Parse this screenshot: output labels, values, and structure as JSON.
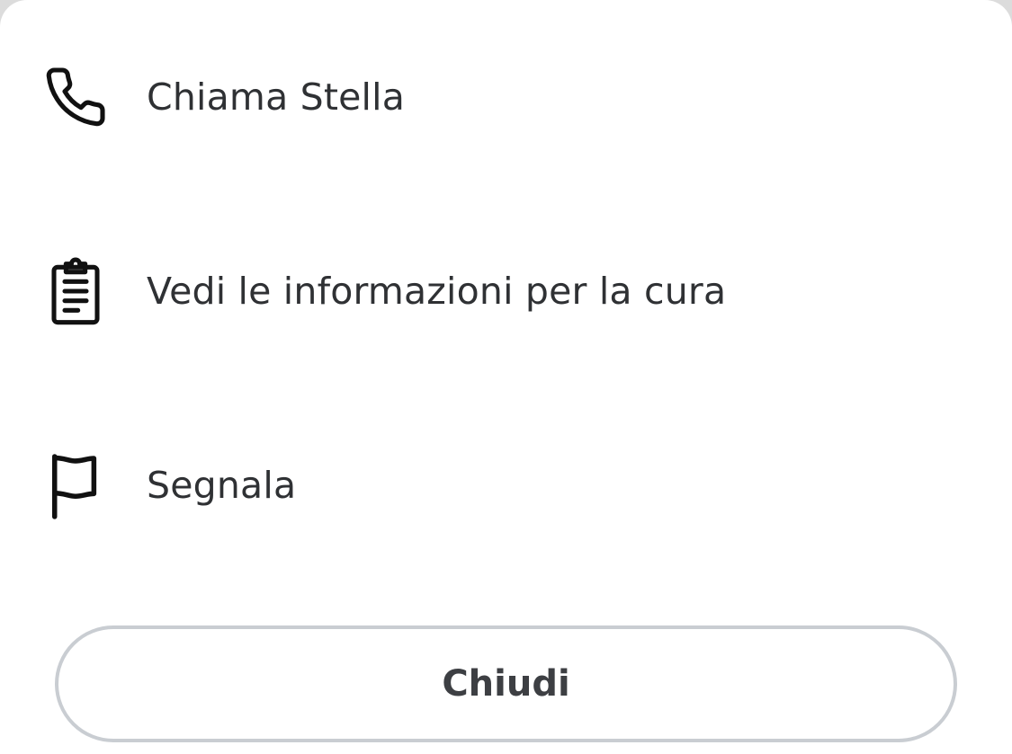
{
  "menu": {
    "items": [
      {
        "label": "Chiama Stella",
        "icon": "phone-icon"
      },
      {
        "label": "Vedi le informazioni per la cura",
        "icon": "clipboard-icon"
      },
      {
        "label": "Segnala",
        "icon": "flag-icon"
      }
    ]
  },
  "close_button": {
    "label": "Chiudi"
  },
  "colors": {
    "text": "#2f3134",
    "button_border": "#c9cdd2",
    "background": "#ffffff"
  }
}
